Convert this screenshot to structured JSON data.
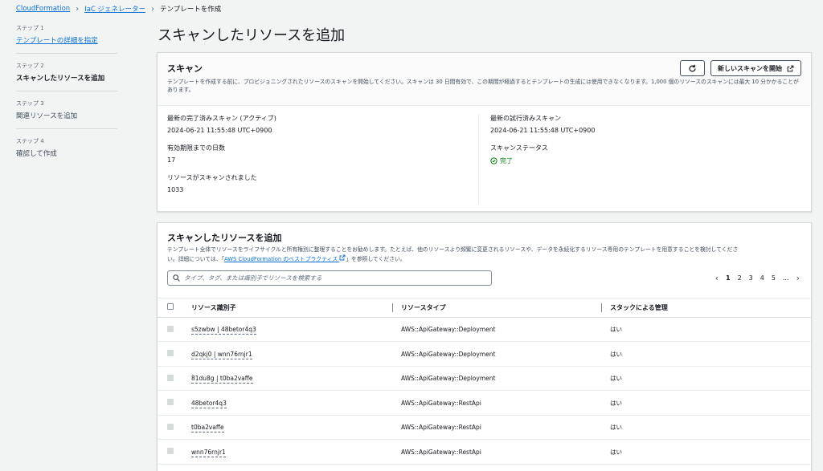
{
  "breadcrumb": {
    "items": [
      "CloudFormation",
      "IaC ジェネレーター",
      "テンプレートを作成"
    ]
  },
  "steps": [
    {
      "num": "ステップ 1",
      "label": "テンプレートの詳細を指定"
    },
    {
      "num": "ステップ 2",
      "label": "スキャンしたリソースを追加"
    },
    {
      "num": "ステップ 3",
      "label": "関連リソースを追加"
    },
    {
      "num": "ステップ 4",
      "label": "確認して作成"
    }
  ],
  "page_title": "スキャンしたリソースを追加",
  "scan_panel": {
    "title": "スキャン",
    "desc": "テンプレートを作成する前に、プロビジョニングされたリソースのスキャンを開始してください。スキャンは 30 日間有効で、この期間が経過するとテンプレートの生成には使用できなくなります。1,000 個のリソースのスキャンには最大 10 分かかることがあります。",
    "new_scan_button": "新しいスキャンを開始",
    "refresh_icon": "refresh-icon",
    "last_completed_label": "最新の完了済みスキャン (アクティブ)",
    "last_completed_value": "2024-06-21 11:55:48 UTC+0900",
    "days_label": "有効期限までの日数",
    "days_value": "17",
    "resources_label": "リソースがスキャンされました",
    "resources_value": "1033",
    "last_attempt_label": "最新の試行済みスキャン",
    "last_attempt_value": "2024-06-21 11:55:48 UTC+0900",
    "status_label": "スキャンステータス",
    "status_value": "完了",
    "status_color": "#037f0c"
  },
  "resources_panel": {
    "title": "スキャンしたリソースを追加",
    "desc_line1": "テンプレート全体でリソースをライフサイクルと所有権別に整理することをお勧めします。たとえば、他のリソースより頻繁に変更されるリソースや、データを永続化するリソース専用のテンプレートを用意することを検討してくださ",
    "desc_pre": "い。詳細については、「",
    "desc_link": "AWS CloudFormation のベストプラクティス",
    "desc_post": "」を参照してください。",
    "search_placeholder": "タイプ、タグ、または識別子でリソースを検索する",
    "pages": [
      "1",
      "2",
      "3",
      "4",
      "5",
      "..."
    ],
    "columns": [
      "リソース識別子",
      "リソースタイプ",
      "スタックによる管理"
    ],
    "rows": [
      {
        "id": "s5zwbw | 48betor4q3",
        "type": "AWS::ApiGateway::Deployment",
        "managed": "はい"
      },
      {
        "id": "d2qkj0 | wnn76rnjr1",
        "type": "AWS::ApiGateway::Deployment",
        "managed": "はい"
      },
      {
        "id": "81du8g | t0ba2vaffe",
        "type": "AWS::ApiGateway::Deployment",
        "managed": "はい"
      },
      {
        "id": "48betor4q3",
        "type": "AWS::ApiGateway::RestApi",
        "managed": "はい"
      },
      {
        "id": "t0ba2vaffe",
        "type": "AWS::ApiGateway::RestApi",
        "managed": "はい"
      },
      {
        "id": "wnn76rnjr1",
        "type": "AWS::ApiGateway::RestApi",
        "managed": "はい"
      }
    ]
  },
  "colors": {
    "link": "#0972d3",
    "success": "#037f0c"
  }
}
